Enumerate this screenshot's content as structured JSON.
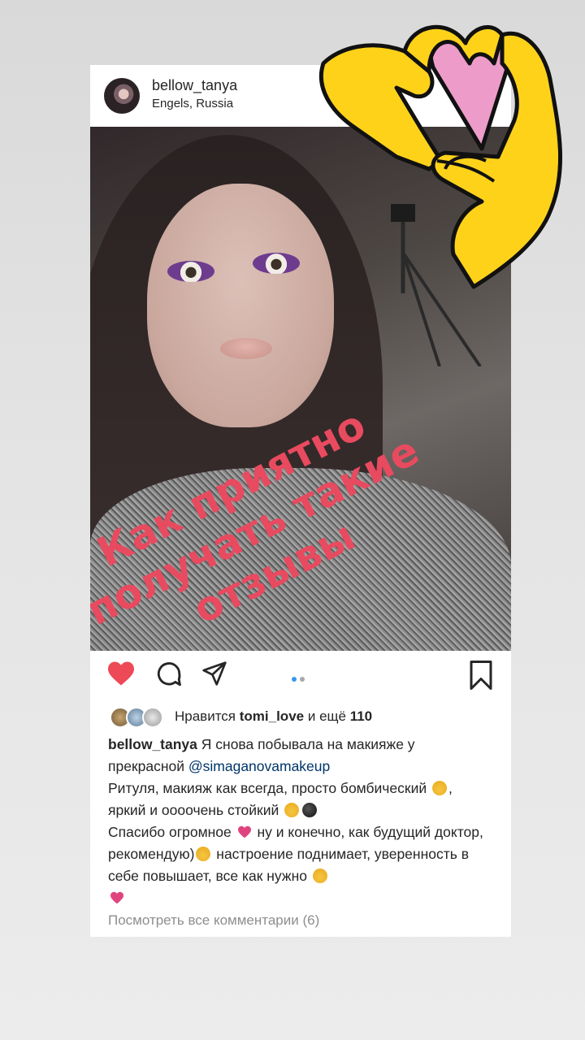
{
  "post": {
    "username": "bellow_tanya",
    "location": "Engels, Russia"
  },
  "overlay": {
    "line1": "Как приятно",
    "line2": "получать такие",
    "line3": "отзывы"
  },
  "likes": {
    "prefix": "Нравится",
    "user": "tomi_love",
    "middle": "и ещё",
    "count": "110"
  },
  "caption": {
    "user": "bellow_tanya",
    "part1": "Я снова побывала на макияже у прекрасной",
    "mention": "@simaganovamakeup",
    "part2": "Ритуля, макияж как всегда, просто бомбический",
    "part3": ", яркий и оооочень стойкий",
    "part4": "Спасибо огромное",
    "part5": "ну и конечно, как будущий доктор, рекомендую)",
    "part6": "настроение поднимает, уверенность в себе повышает, все как нужно"
  },
  "comments_link": "Посмотреть все комментарии (6)",
  "carousel": {
    "current": 1,
    "total": 2
  },
  "icons": [
    "heart-icon",
    "comment-icon",
    "share-icon",
    "bookmark-icon",
    "heart-hands-sticker"
  ],
  "colors": {
    "accent_red": "#ed4956",
    "overlay_text": "#e84a5f",
    "dot_active": "#3897f0",
    "sticker_yellow": "#ffd21a",
    "sticker_pink": "#ed9cc9"
  }
}
